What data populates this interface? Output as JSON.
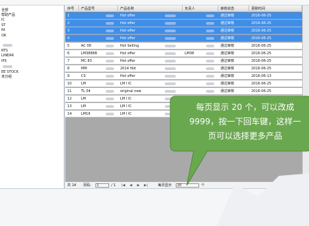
{
  "tree": {
    "items": [
      {
        "label": "全部"
      },
      {
        "label": "帮助产品"
      },
      {
        "label": "IC"
      },
      {
        "label": "ST"
      },
      {
        "label": "NI"
      },
      {
        "label": "OK"
      },
      {
        "label": ""
      },
      {
        "label": "RTS"
      },
      {
        "label": "LINEAR"
      },
      {
        "label": "IPS"
      },
      {
        "label": ""
      },
      {
        "label": "EE  STOCK"
      },
      {
        "label": "未分组"
      }
    ]
  },
  "grid": {
    "columns": [
      "序号",
      "产品型号",
      "产品名称",
      "负责人",
      "审核状态",
      "更新时间"
    ],
    "rows": [
      {
        "no": "1",
        "model": "",
        "name": "Hot offer",
        "owner": "",
        "status": "通过审核",
        "date": "2016-06-25",
        "selected": true
      },
      {
        "no": "2",
        "model": "",
        "name": "Hot offer",
        "owner": "",
        "status": "通过审核",
        "date": "2016-06-25",
        "selected": true
      },
      {
        "no": "3",
        "model": "",
        "name": "Hot offer",
        "owner": "",
        "status": "通过审核",
        "date": "2016-06-25",
        "selected": true
      },
      {
        "no": "4",
        "model": "",
        "name": "Hot offer",
        "owner": "",
        "status": "通过审核",
        "date": "2016-06-25",
        "selected": true
      },
      {
        "no": "5",
        "model": "AC    08",
        "name": "Hot Selling",
        "owner": "",
        "status": "通过审核",
        "date": "2016-06-25",
        "selected": false
      },
      {
        "no": "6",
        "model": "LM3886B",
        "name": "Hot offer",
        "owner": "LM38",
        "status": "通过审核",
        "date": "2016-06-25",
        "selected": false
      },
      {
        "no": "7",
        "model": "MC    83",
        "name": "Hot offer",
        "owner": "",
        "status": "通过审核",
        "date": "2016-06-25",
        "selected": false
      },
      {
        "no": "8",
        "model": "MM",
        "name": "2014 Hot",
        "owner": "",
        "status": "通过审核",
        "date": "2016-06-25",
        "selected": false
      },
      {
        "no": "9",
        "model": "CS",
        "name": "Hot offer",
        "owner": "",
        "status": "通过审核",
        "date": "2016-06-13",
        "selected": false
      },
      {
        "no": "10",
        "model": "LM",
        "name": "LM  I  IC",
        "owner": "",
        "status": "通过审核",
        "date": "2016-06-25",
        "selected": false
      },
      {
        "no": "11",
        "model": "TL    04",
        "name": "original new",
        "owner": "",
        "status": "通过审核",
        "date": "2016-06-25",
        "selected": false
      },
      {
        "no": "12",
        "model": "LM",
        "name": "LM  I  IC",
        "owner": "",
        "status": "通过审核",
        "date": "2016-06-25",
        "selected": false
      },
      {
        "no": "13",
        "model": "LM",
        "name": "LM  I  IC",
        "owner": "",
        "status": "",
        "date": "",
        "selected": false
      },
      {
        "no": "14",
        "model": "LM19",
        "name": "LM  I  IC",
        "owner": "",
        "status": "",
        "date": "",
        "selected": false
      }
    ]
  },
  "pager": {
    "total_label": "共 14",
    "page_label": "页码:",
    "page_value": "1",
    "page_total": "/ 1",
    "first_btn": "|◀",
    "prev_btn": "◀",
    "next_btn": "▶",
    "last_btn": "▶|",
    "page_size_label": "每页显示",
    "page_size_value": "20",
    "unit": "个"
  },
  "callout": {
    "line1": "每页显示 20 个，可以改成",
    "line2": "9999，按一下回车键，这样一",
    "line3": "页可以选择更多产品",
    "color": "#6aa84f"
  }
}
